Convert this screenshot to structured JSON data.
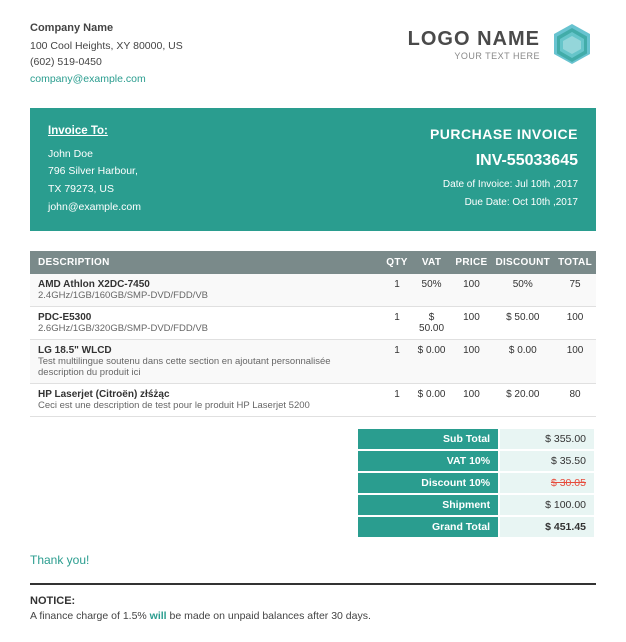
{
  "company": {
    "name": "Company Name",
    "address1": "100 Cool Heights, XY 80000, US",
    "phone": "(602) 519-0450",
    "email": "company@example.com"
  },
  "logo": {
    "name": "LOGO NAME",
    "tagline": "YOUR TEXT HERE"
  },
  "invoice": {
    "title": "PURCHASE INVOICE",
    "number": "INV-55033645",
    "date_label": "Date of Invoice:",
    "date_value": "Jul 10th ,2017",
    "due_label": "Due Date:",
    "due_value": "Oct 10th ,2017",
    "to_label": "Invoice To:",
    "recipient": {
      "name": "John Doe",
      "address1": "796 Silver Harbour,",
      "address2": "TX 79273, US",
      "email": "john@example.com"
    }
  },
  "table": {
    "headers": [
      "DESCRIPTION",
      "QTY",
      "VAT",
      "PRICE",
      "DISCOUNT",
      "TOTAL"
    ],
    "rows": [
      {
        "title": "AMD Athlon X2DC-7450",
        "subtitle": "2.4GHz/1GB/160GB/SMP-DVD/FDD/VB",
        "qty": "1",
        "vat": "50%",
        "price": "100",
        "discount": "50%",
        "total": "75"
      },
      {
        "title": "PDC-E5300",
        "subtitle": "2.6GHz/1GB/320GB/SMP-DVD/FDD/VB",
        "qty": "1",
        "vat": "$ 50.00",
        "price": "100",
        "discount": "$ 50.00",
        "total": "100"
      },
      {
        "title": "LG 18.5\" WLCD",
        "subtitle": "Test multilingue soutenu dans cette section en ajoutant personnalisée description du produit ici",
        "qty": "1",
        "vat": "$ 0.00",
        "price": "100",
        "discount": "$ 0.00",
        "total": "100"
      },
      {
        "title": "HP Laserjet (Citroën) złśżąc",
        "subtitle": "Ceci est une description de test pour le produit HP Laserjet 5200",
        "qty": "1",
        "vat": "$ 0.00",
        "price": "100",
        "discount": "$ 20.00",
        "total": "80"
      }
    ]
  },
  "totals": {
    "subtotal_label": "Sub Total",
    "subtotal_value": "$ 355.00",
    "vat_label": "VAT 10%",
    "vat_value": "$ 35.50",
    "discount_label": "Discount 10%",
    "discount_value": "$ 30.05",
    "shipment_label": "Shipment",
    "shipment_value": "$ 100.00",
    "grandtotal_label": "Grand Total",
    "grandtotal_value": "$ 451.45"
  },
  "thankyou": "Thank you!",
  "notice": {
    "title": "NOTICE:",
    "text_before": "A finance charge of 1.5%",
    "highlighted": "will",
    "text_after": "be made on unpaid balances after 30 days."
  }
}
